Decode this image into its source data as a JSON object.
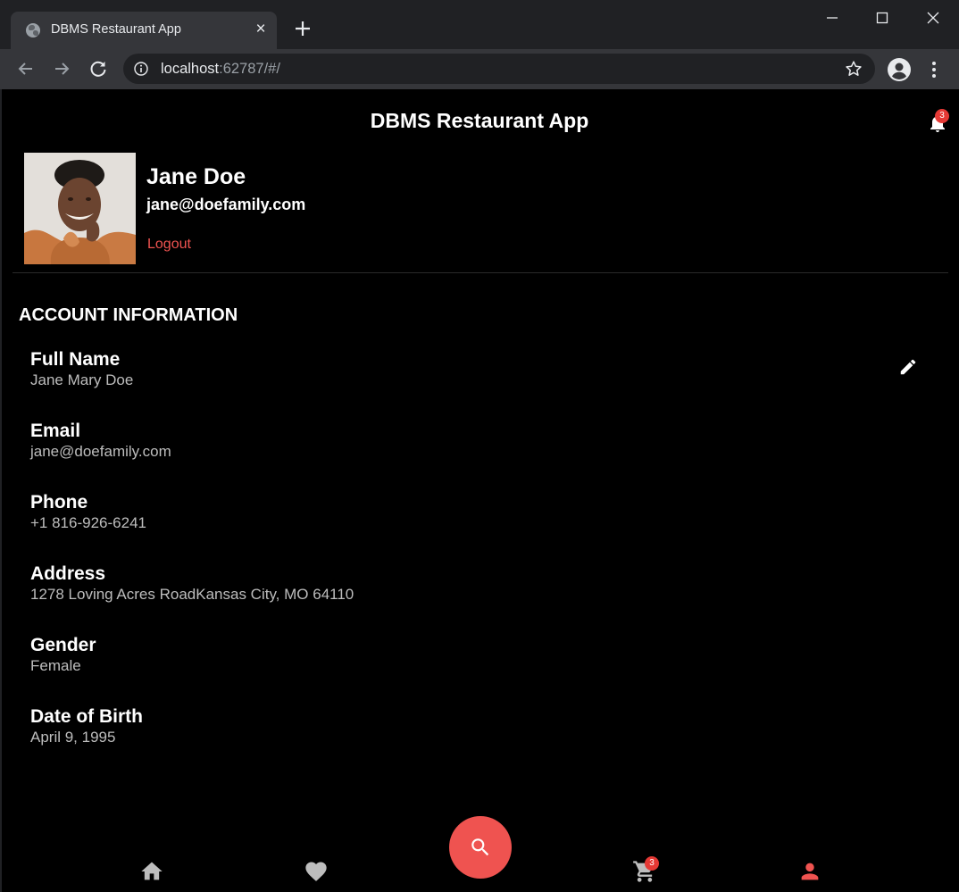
{
  "browser": {
    "tab_title": "DBMS Restaurant App",
    "url_host": "localhost",
    "url_rest": ":62787/#/"
  },
  "app": {
    "title": "DBMS Restaurant App",
    "notification_count": "3"
  },
  "profile": {
    "name": "Jane Doe",
    "email": "jane@doefamily.com",
    "logout_label": "Logout"
  },
  "account": {
    "section_title": "ACCOUNT INFORMATION",
    "fields": [
      {
        "label": "Full Name",
        "value": "Jane Mary Doe"
      },
      {
        "label": "Email",
        "value": "jane@doefamily.com"
      },
      {
        "label": "Phone",
        "value": "+1 816-926-6241"
      },
      {
        "label": "Address",
        "value": "1278 Loving Acres RoadKansas City, MO 64110"
      },
      {
        "label": "Gender",
        "value": "Female"
      },
      {
        "label": "Date of Birth",
        "value": "April 9, 1995"
      }
    ]
  },
  "bottom_nav": {
    "cart_count": "3",
    "items": [
      "home-icon",
      "heart-icon",
      "search-icon",
      "cart-icon",
      "person-icon"
    ],
    "active_item": "person-icon"
  },
  "colors": {
    "accent": "#ef5350",
    "badge": "#e53935",
    "background": "#000000",
    "inactive_icon": "#bdbdbd"
  }
}
